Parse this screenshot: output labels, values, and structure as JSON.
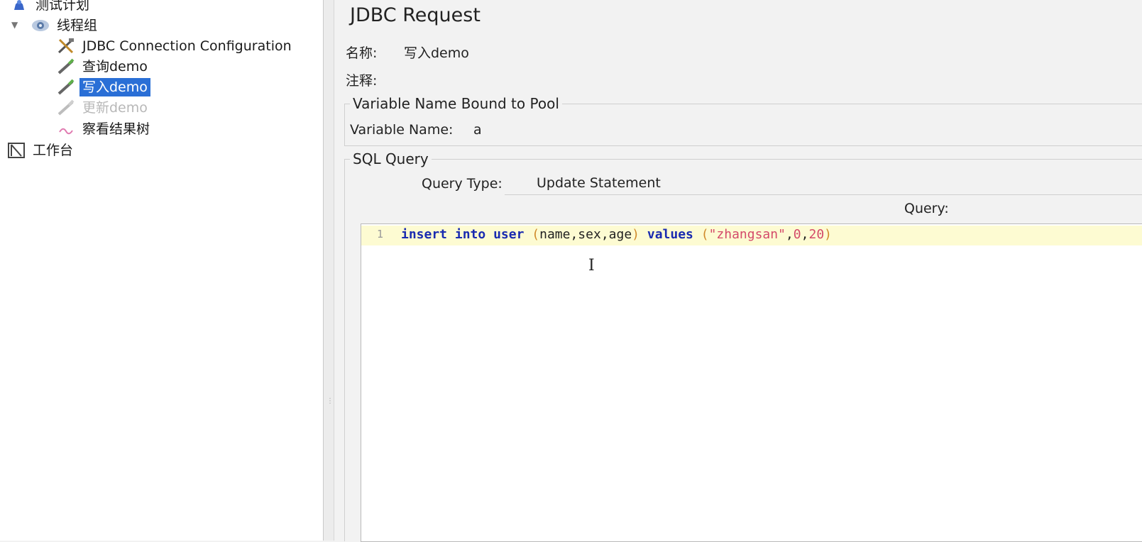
{
  "tree": {
    "items": [
      {
        "label": "测试计划",
        "icon": "test-plan-icon"
      },
      {
        "label": "线程组",
        "icon": "thread-group-icon"
      },
      {
        "label": "JDBC Connection Configuration",
        "icon": "config-tools-icon"
      },
      {
        "label": "查询demo",
        "icon": "sampler-pen-icon"
      },
      {
        "label": "写入demo",
        "icon": "sampler-pen-icon",
        "selected": true
      },
      {
        "label": "更新demo",
        "icon": "sampler-pen-icon",
        "disabled": true
      },
      {
        "label": "察看结果树",
        "icon": "listener-wave-icon"
      },
      {
        "label": "工作台",
        "icon": "workbench-icon"
      }
    ]
  },
  "panel": {
    "title": "JDBC Request",
    "name_label": "名称:",
    "name_value": "写入demo",
    "comment_label": "注释:",
    "pool_group_title": "Variable Name Bound to Pool",
    "variable_name_label": "Variable Name:",
    "variable_name_value": "a",
    "sql_group_title": "SQL Query",
    "query_type_label": "Query Type:",
    "query_type_value": "Update Statement",
    "query_label": "Query:",
    "editor": {
      "line_number": "1",
      "tokens": {
        "insert": "insert",
        "into": "into",
        "user": "user",
        "open1": "(",
        "cols": "name,sex,age",
        "close1": ")",
        "values": "values",
        "open2": "(",
        "str": "\"zhangsan\"",
        "comma1": ",",
        "num0": "0",
        "comma2": ",",
        "num20": "20",
        "close2": ")"
      }
    }
  },
  "colors": {
    "selection": "#2a6fd6",
    "keyword": "#1a2bb0",
    "paren": "#d08a2a",
    "string": "#d44a6a",
    "current_line": "#fdfbd2"
  }
}
